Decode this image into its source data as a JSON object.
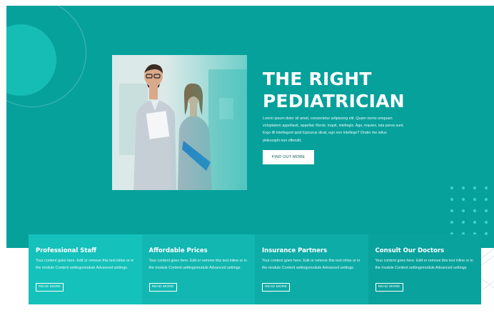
{
  "hero": {
    "title_line1": "THE RIGHT",
    "title_line2": "PEDIATRICIAN",
    "description": "Lorem ipsum dolor sit amet, consectetur adipiscing elit. Quam nemo umquam voluptatem appellavit, appellat; Recte, inquit, intellegis. Age, inquies, ista parva sunt. Ergo illi intellegunt quid Epicurus dicat, ego non intellego? Oratio me istius philosophi non offendit;",
    "button_label": "FIND OUT MORE",
    "photo_icon": "doctors-photo"
  },
  "cards": [
    {
      "title": "Professional Staff",
      "text": "Your content goes here. Edit or remove this text inline or in the module Content settingsmodule Advanced settings.",
      "button": "READ MORE",
      "color": "#15c1bb"
    },
    {
      "title": "Affordable Prices",
      "text": "Your content goes here. Edit or remove this text inline or in the module Content settingsmodule Advanced settings.",
      "button": "READ MORE",
      "color": "#12b7b1"
    },
    {
      "title": "Insurance Partners",
      "text": "Your content goes here. Edit or remove this text inline or in the module Content settingsmodule Advanced settings.",
      "button": "READ MORE",
      "color": "#0eaca7"
    },
    {
      "title": "Consult Our Doctors",
      "text": "Your content goes here. Edit or remove this text inline or in the module Content settingsmodule Advanced settings.",
      "button": "READ MORE",
      "color": "#0aa29d"
    }
  ],
  "colors": {
    "hero_background": "#07a19c",
    "accent_circle": "#15bdb5",
    "dot_pattern": "#3fd4cb"
  }
}
